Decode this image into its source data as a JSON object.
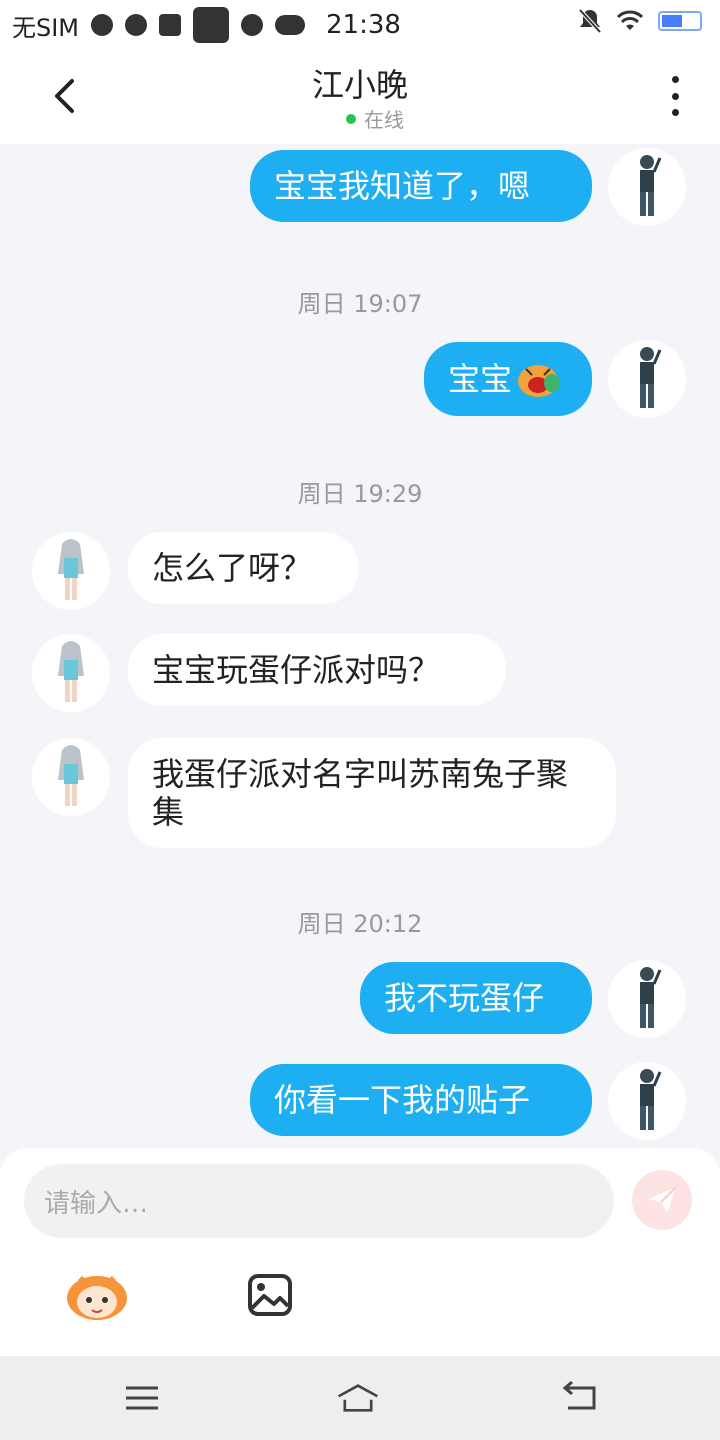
{
  "status_bar": {
    "carrier": "无SIM",
    "time": "21:38"
  },
  "header": {
    "title": "江小晚",
    "status": "在线"
  },
  "messages": [
    {
      "text": "宝宝我知道了，嗯"
    },
    {
      "timestamp": "周日 19:07"
    },
    {
      "text": "宝宝"
    },
    {
      "timestamp": "周日 19:29"
    },
    {
      "text": "怎么了呀？"
    },
    {
      "text": "宝宝玩蛋仔派对吗？"
    },
    {
      "text": "我蛋仔派对名字叫苏南兔子聚集"
    },
    {
      "timestamp": "周日 20:12"
    },
    {
      "text": "我不玩蛋仔"
    },
    {
      "text": "你看一下我的贴子"
    }
  ],
  "composer": {
    "placeholder": "请输入…"
  },
  "colors": {
    "outgoing": "#1eaef2",
    "incoming": "#ffffff",
    "background": "#f3f5f8",
    "online": "#2ac24c"
  }
}
